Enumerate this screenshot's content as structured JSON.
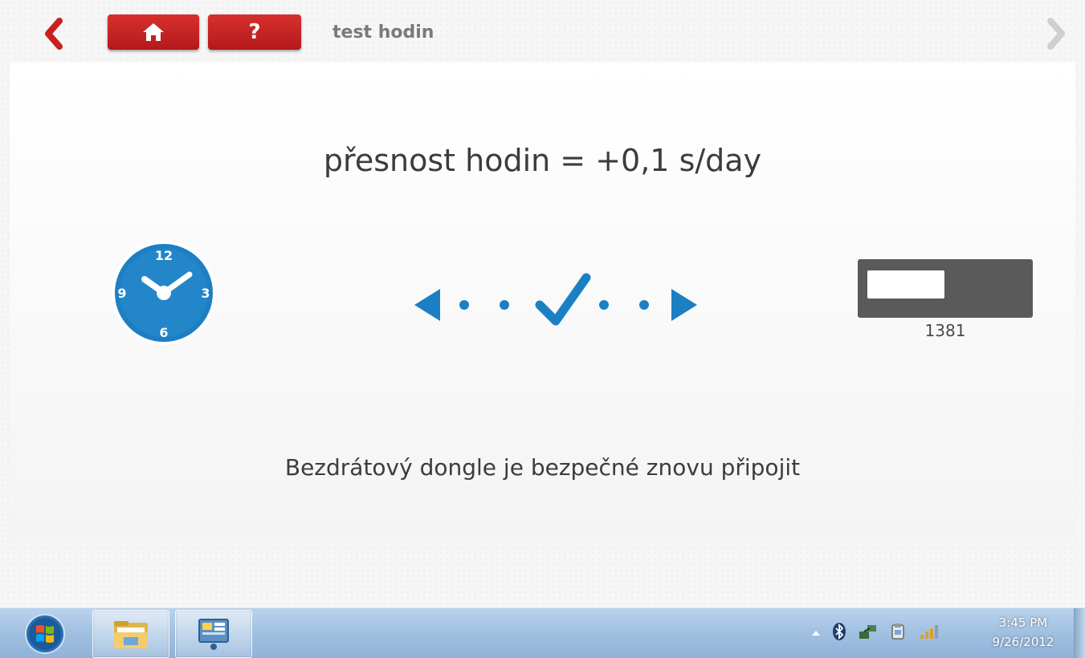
{
  "header": {
    "title": "test hodin",
    "home_icon": "home-icon",
    "help_label": "?",
    "back_icon": "chevron-left-icon",
    "forward_icon": "chevron-right-icon",
    "accent_color": "#c8201f"
  },
  "main": {
    "result_text": "přesnost hodin = +0,1 s/day",
    "clock_labels": {
      "n12": "12",
      "n3": "3",
      "n6": "6",
      "n9": "9"
    },
    "device_serial": "1381",
    "message": "Bezdrátový dongle je bezpečné znovu připojit",
    "status_color": "#1c7fc4"
  },
  "taskbar": {
    "start_icon": "windows-start-icon",
    "items": [
      "file-explorer-icon",
      "app-icon"
    ],
    "tray_icons": [
      "show-hidden-icons-icon",
      "bluetooth-icon",
      "network-device-icon",
      "usb-icon",
      "signal-strength-icon"
    ],
    "time": "3:45 PM",
    "date": "9/26/2012"
  }
}
